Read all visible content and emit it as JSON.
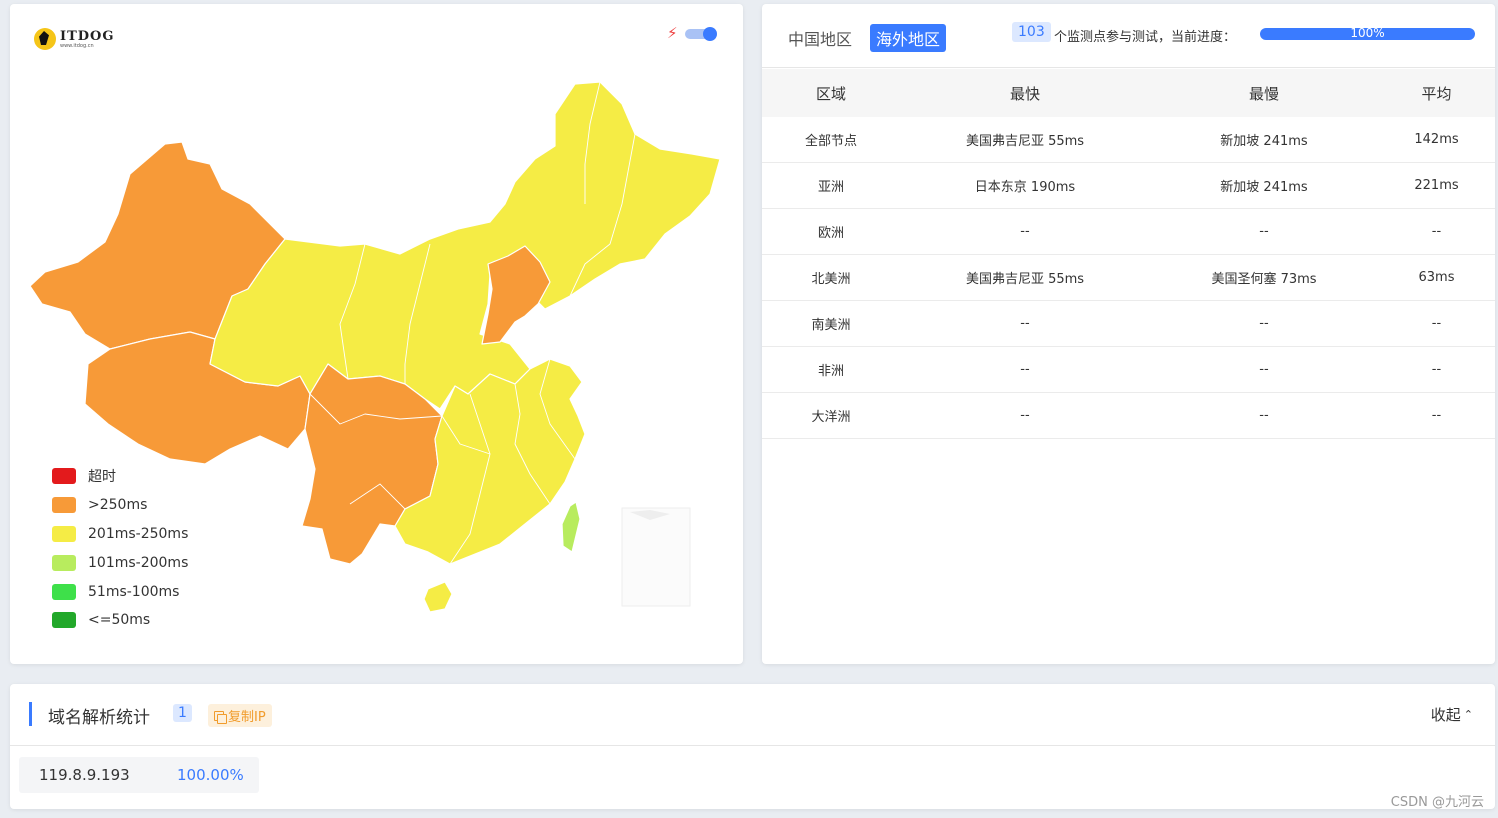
{
  "logo": {
    "name": "ITDOG",
    "url": "www.itdog.cn"
  },
  "legend": [
    {
      "label": "超时",
      "color": "#e31a1c"
    },
    {
      "label": ">250ms",
      "color": "#f79a38"
    },
    {
      "label": "201ms-250ms",
      "color": "#f5ec45"
    },
    {
      "label": "101ms-200ms",
      "color": "#b8ec5e"
    },
    {
      "label": "51ms-100ms",
      "color": "#3ee04a"
    },
    {
      "label": "<=50ms",
      "color": "#22a82a"
    }
  ],
  "colors": {
    "accent": "#3a7bff",
    "orange": "#f79a38",
    "yellow": "#f5ec45",
    "green": "#b8ec5e"
  },
  "tabs": {
    "china": "中国地区",
    "overseas": "海外地区"
  },
  "monitor": {
    "count": "103",
    "text": "个监测点参与测试，当前进度：",
    "progress": 100,
    "progress_label": "100%"
  },
  "table": {
    "headers": [
      "区域",
      "最快",
      "最慢",
      "平均"
    ],
    "rows": [
      [
        "全部节点",
        "美国弗吉尼亚 55ms",
        "新加坡 241ms",
        "142ms"
      ],
      [
        "亚洲",
        "日本东京 190ms",
        "新加坡 241ms",
        "221ms"
      ],
      [
        "欧洲",
        "--",
        "--",
        "--"
      ],
      [
        "北美洲",
        "美国弗吉尼亚 55ms",
        "美国圣何塞 73ms",
        "63ms"
      ],
      [
        "南美洲",
        "--",
        "--",
        "--"
      ],
      [
        "非洲",
        "--",
        "--",
        "--"
      ],
      [
        "大洋洲",
        "--",
        "--",
        "--"
      ]
    ]
  },
  "dns": {
    "title": "域名解析统计",
    "count": "1",
    "copy_label": "复制IP",
    "collapse_label": "收起",
    "ip": "119.8.9.193",
    "percent": "100.00%"
  },
  "watermark": "CSDN @九河云"
}
